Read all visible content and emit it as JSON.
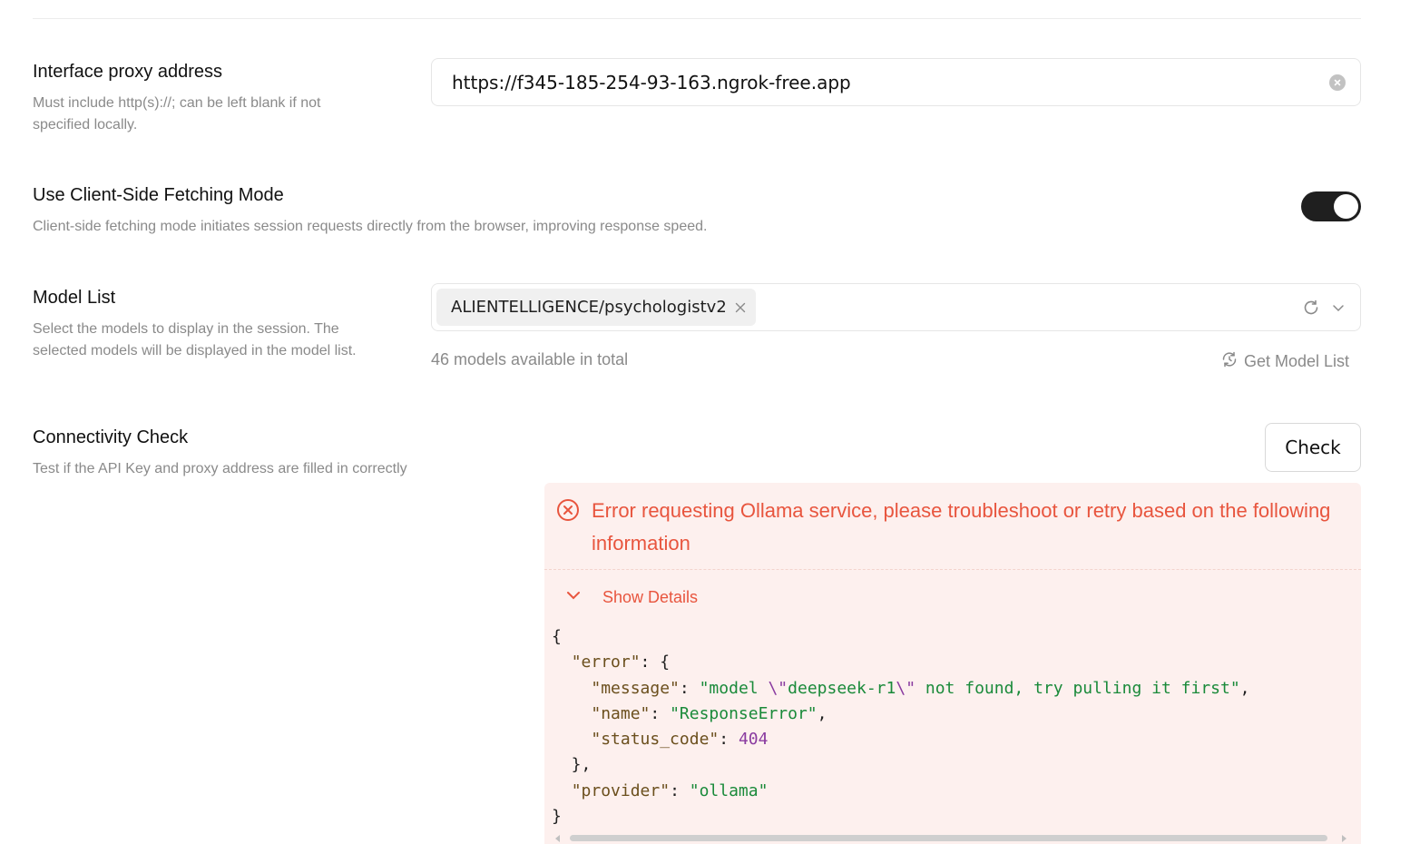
{
  "proxy": {
    "title": "Interface proxy address",
    "desc_line1": "Must include http(s)://; can be left blank if not",
    "desc_line2": "specified locally.",
    "value": "https://f345-185-254-93-163.ngrok-free.app",
    "clear_icon": "clear-circle-icon"
  },
  "client_fetch": {
    "title": "Use Client-Side Fetching Mode",
    "desc": "Client-side fetching mode initiates session requests directly from the browser, improving response speed.",
    "enabled": true
  },
  "model_list": {
    "title": "Model List",
    "desc_line1": "Select the models to display in the session. The",
    "desc_line2": "selected models will be displayed in the model list.",
    "selected": [
      "ALIENTELLIGENCE/psychologistv2"
    ],
    "count_text": "46 models available in total",
    "get_list_label": "Get Model List"
  },
  "connectivity": {
    "title": "Connectivity Check",
    "desc": "Test if the API Key and proxy address are filled in correctly",
    "check_label": "Check",
    "error": {
      "message": "Error requesting Ollama service, please troubleshoot or retry based on the following information",
      "details_label": "Show Details",
      "json": {
        "open": "{",
        "error_key": "\"error\"",
        "message_key": "\"message\"",
        "message_val_a": "\"model ",
        "esc1": "\\\"",
        "message_val_b": "deepseek-r1",
        "esc2": "\\\"",
        "message_val_c": " not found, try pulling it first\"",
        "name_key": "\"name\"",
        "name_val": "\"ResponseError\"",
        "status_key": "\"status_code\"",
        "status_val": "404",
        "provider_key": "\"provider\"",
        "provider_val": "\"ollama\"",
        "close": "}"
      }
    }
  },
  "colors": {
    "error_text": "#e8553e",
    "error_bg": "#fdf0ee",
    "toggle_on": "#1f1f1f"
  }
}
